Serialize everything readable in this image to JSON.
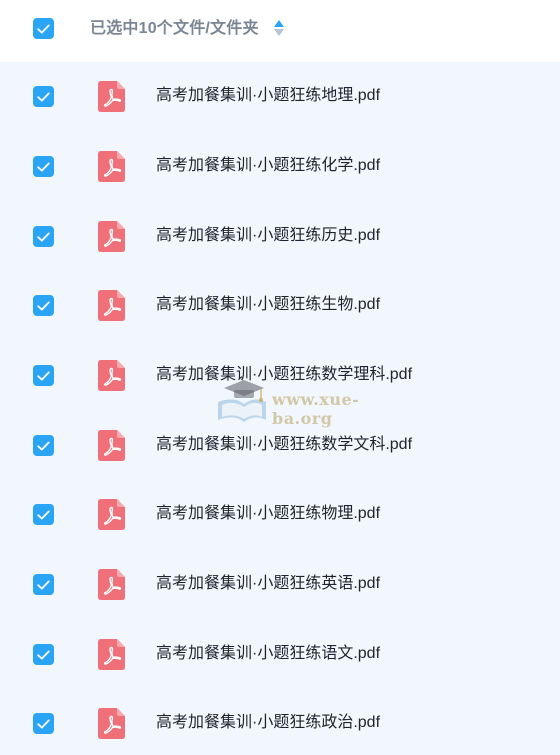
{
  "header": {
    "selection_text": "已选中10个文件/文件夹",
    "select_all_checked": true,
    "sort_icon": "sort-updown-icon"
  },
  "files": [
    {
      "name": "高考加餐集训·小题狂练地理.pdf",
      "checked": true,
      "icon": "pdf-icon"
    },
    {
      "name": "高考加餐集训·小题狂练化学.pdf",
      "checked": true,
      "icon": "pdf-icon"
    },
    {
      "name": "高考加餐集训·小题狂练历史.pdf",
      "checked": true,
      "icon": "pdf-icon"
    },
    {
      "name": "高考加餐集训·小题狂练生物.pdf",
      "checked": true,
      "icon": "pdf-icon"
    },
    {
      "name": "高考加餐集训·小题狂练数学理科.pdf",
      "checked": true,
      "icon": "pdf-icon"
    },
    {
      "name": "高考加餐集训·小题狂练数学文科.pdf",
      "checked": true,
      "icon": "pdf-icon"
    },
    {
      "name": "高考加餐集训·小题狂练物理.pdf",
      "checked": true,
      "icon": "pdf-icon"
    },
    {
      "name": "高考加餐集训·小题狂练英语.pdf",
      "checked": true,
      "icon": "pdf-icon"
    },
    {
      "name": "高考加餐集训·小题狂练语文.pdf",
      "checked": true,
      "icon": "pdf-icon"
    },
    {
      "name": "高考加餐集训·小题狂练政治.pdf",
      "checked": true,
      "icon": "pdf-icon"
    }
  ],
  "watermark": {
    "text": "www.xue-ba.org",
    "icon": "graduation-cap-book-icon"
  },
  "colors": {
    "checkbox": "#2aa4f4",
    "pdf_icon": "#f0707a",
    "list_background": "#f2f7fd",
    "header_text": "#7b8694",
    "file_text": "#1d2330"
  }
}
